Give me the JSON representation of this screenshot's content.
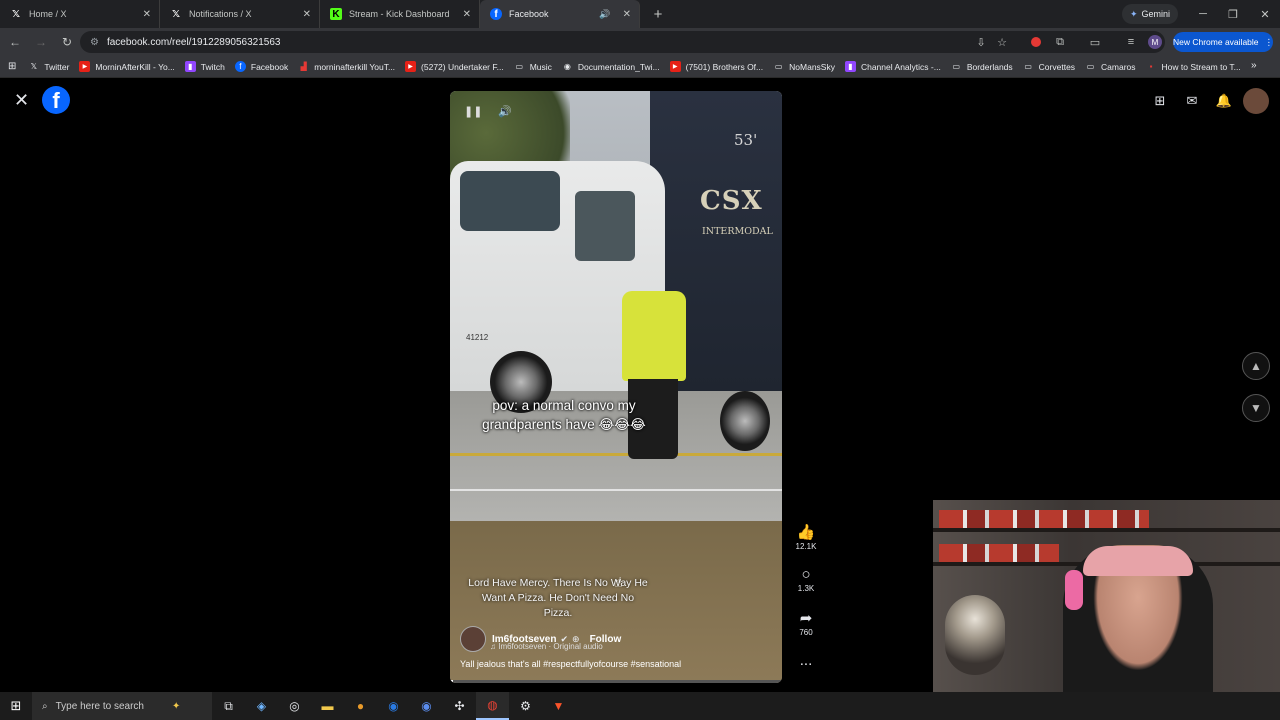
{
  "browser": {
    "tabs": [
      {
        "label": "Home / X",
        "icon": "x-logo-icon"
      },
      {
        "label": "Notifications / X",
        "icon": "x-logo-icon"
      },
      {
        "label": "Stream - Kick Dashboard",
        "icon": "kick-logo-icon"
      },
      {
        "label": "Facebook",
        "icon": "facebook-logo-icon",
        "active": true
      }
    ],
    "gemini_label": "Gemini",
    "url": "facebook.com/reel/1912289056321563",
    "new_chrome_label": "New Chrome available",
    "profile_initial": "M"
  },
  "bookmarks": [
    {
      "label": "Twitter",
      "icon": "x-logo-icon"
    },
    {
      "label": "MorninAfterKill - Yo...",
      "icon": "youtube-icon"
    },
    {
      "label": "Twitch",
      "icon": "twitch-icon"
    },
    {
      "label": "Facebook",
      "icon": "facebook-logo-icon"
    },
    {
      "label": "morninafterkill YouT...",
      "icon": "analytics-icon"
    },
    {
      "label": "(5272) Undertaker F...",
      "icon": "youtube-icon"
    },
    {
      "label": "Music",
      "icon": "folder-icon"
    },
    {
      "label": "Documentation_Twi...",
      "icon": "github-icon"
    },
    {
      "label": "(7501) Brothers Of...",
      "icon": "youtube-icon"
    },
    {
      "label": "NoMansSky",
      "icon": "folder-icon"
    },
    {
      "label": "Channel Analytics -...",
      "icon": "twitch-icon"
    },
    {
      "label": "Borderlands",
      "icon": "folder-icon"
    },
    {
      "label": "Corvettes",
      "icon": "folder-icon"
    },
    {
      "label": "Camaros",
      "icon": "folder-icon"
    },
    {
      "label": "How to Stream to T...",
      "icon": "page-icon"
    }
  ],
  "reel": {
    "overlay_caption": "pov: a normal convo my grandparents have 😂😂😂",
    "subtitle": "Lord Have Mercy. There Is No Way He Want A Pizza. He Don't Need No Pizza.",
    "truck_text_53": "53'",
    "truck_text_csx": "CSX",
    "truck_text_intermodal": "INTERMODAL",
    "truck_number": "41212",
    "author": "Im6footseven",
    "follow_label": "Follow",
    "audio": "♫ Im6footseven · Original audio",
    "description": "Yall jealous that's all #respectfullyofcourse #sensational",
    "progress_fraction": 0.01
  },
  "actions": {
    "likes": "12.1K",
    "comments": "1.3K",
    "shares": "760",
    "more": "..."
  },
  "taskbar": {
    "search_placeholder": "Type here to search"
  },
  "colors": {
    "facebook_blue": "#0866ff",
    "chrome_blue": "#0b57d0"
  }
}
